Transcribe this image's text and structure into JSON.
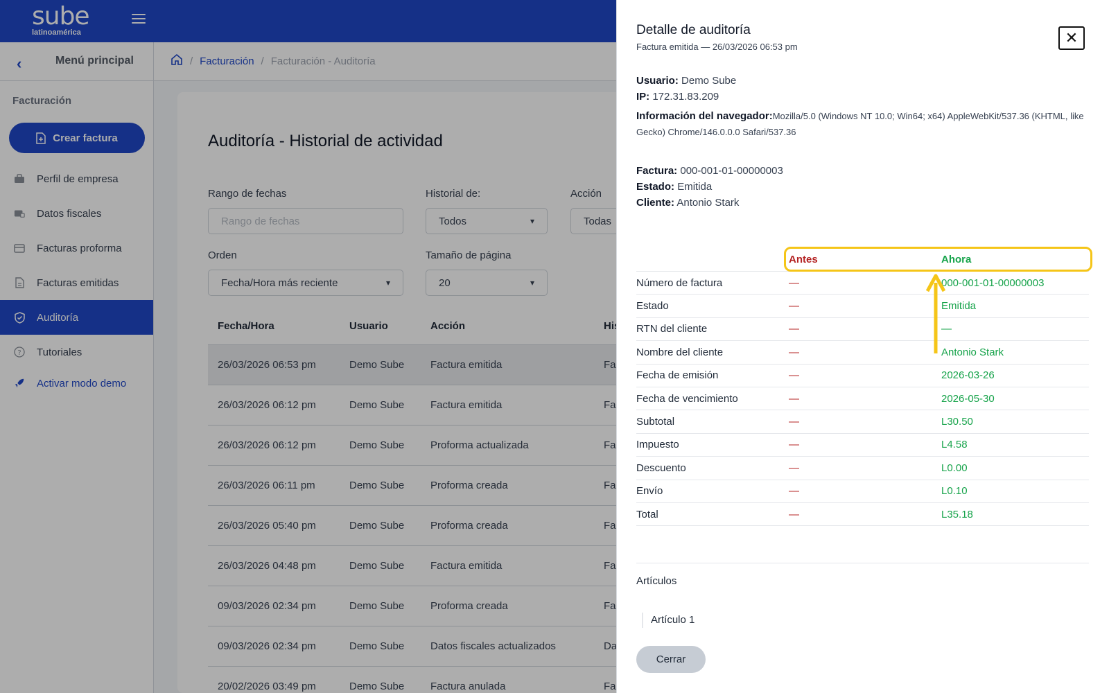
{
  "brand": {
    "name": "sube",
    "tagline": "latinoamérica"
  },
  "sidebar": {
    "menu_title": "Menú principal",
    "section": "Facturación",
    "create_button": "Crear factura",
    "items": [
      {
        "label": "Perfil de empresa",
        "icon": "briefcase-icon"
      },
      {
        "label": "Datos fiscales",
        "icon": "fiscal-data-icon"
      },
      {
        "label": "Facturas proforma",
        "icon": "proforma-icon"
      },
      {
        "label": "Facturas emitidas",
        "icon": "document-icon"
      },
      {
        "label": "Auditoría",
        "icon": "shield-icon",
        "active": true
      },
      {
        "label": "Tutoriales",
        "icon": "help-icon"
      }
    ],
    "demo_label": "Activar modo demo"
  },
  "breadcrumb": {
    "sep": "/",
    "section": "Facturación",
    "current": "Facturación - Auditoría"
  },
  "main": {
    "title": "Auditoría - Historial de actividad",
    "filters": {
      "date_range_label": "Rango de fechas",
      "date_range_placeholder": "Rango de fechas",
      "history_label": "Historial de:",
      "history_value": "Todos",
      "action_label": "Acción",
      "action_value": "Todas",
      "order_label": "Orden",
      "order_value": "Fecha/Hora más reciente",
      "page_size_label": "Tamaño de página",
      "page_size_value": "20"
    },
    "table": {
      "headers": [
        "Fecha/Hora",
        "Usuario",
        "Acción",
        "His"
      ],
      "rows": [
        [
          "26/03/2026 06:53 pm",
          "Demo Sube",
          "Factura emitida",
          "Fac"
        ],
        [
          "26/03/2026 06:12 pm",
          "Demo Sube",
          "Factura emitida",
          "Fac"
        ],
        [
          "26/03/2026 06:12 pm",
          "Demo Sube",
          "Proforma actualizada",
          "Fac"
        ],
        [
          "26/03/2026 06:11 pm",
          "Demo Sube",
          "Proforma creada",
          "Fac"
        ],
        [
          "26/03/2026 05:40 pm",
          "Demo Sube",
          "Proforma creada",
          "Fac"
        ],
        [
          "26/03/2026 04:48 pm",
          "Demo Sube",
          "Factura emitida",
          "Fac"
        ],
        [
          "09/03/2026 02:34 pm",
          "Demo Sube",
          "Proforma creada",
          "Fac"
        ],
        [
          "09/03/2026 02:34 pm",
          "Demo Sube",
          "Datos fiscales actualizados",
          "Da"
        ],
        [
          "20/02/2026 03:49 pm",
          "Demo Sube",
          "Factura anulada",
          "Fac"
        ]
      ]
    }
  },
  "drawer": {
    "title": "Detalle de auditoría",
    "subtitle": "Factura emitida — 26/03/2026 06:53 pm",
    "user_label": "Usuario:",
    "user_value": "Demo Sube",
    "ip_label": "IP:",
    "ip_value": "172.31.83.209",
    "browser_label": "Información del navegador:",
    "browser_value": "Mozilla/5.0 (Windows NT 10.0; Win64; x64) AppleWebKit/537.36 (KHTML, like Gecko) Chrome/146.0.0.0 Safari/537.36",
    "invoice_label": "Factura:",
    "invoice_value": "000-001-01-00000003",
    "status_label": "Estado:",
    "status_value": "Emitida",
    "client_label": "Cliente:",
    "client_value": "Antonio Stark",
    "before_header": "Antes",
    "after_header": "Ahora",
    "changes": [
      {
        "field": "Número de factura",
        "before": "—",
        "after": "000-001-01-00000003"
      },
      {
        "field": "Estado",
        "before": "—",
        "after": "Emitida"
      },
      {
        "field": "RTN del cliente",
        "before": "—",
        "after": "—"
      },
      {
        "field": "Nombre del cliente",
        "before": "—",
        "after": "Antonio Stark"
      },
      {
        "field": "Fecha de emisión",
        "before": "—",
        "after": "2026-03-26"
      },
      {
        "field": "Fecha de vencimiento",
        "before": "—",
        "after": "2026-05-30"
      },
      {
        "field": "Subtotal",
        "before": "—",
        "after": "L30.50"
      },
      {
        "field": "Impuesto",
        "before": "—",
        "after": "L4.58"
      },
      {
        "field": "Descuento",
        "before": "—",
        "after": "L0.00"
      },
      {
        "field": "Envío",
        "before": "—",
        "after": "L0.10"
      },
      {
        "field": "Total",
        "before": "—",
        "after": "L35.18"
      }
    ],
    "articles_label": "Artículos",
    "article_item": "Artículo 1",
    "close_button": "Cerrar",
    "annotation_color": "#f5c518"
  }
}
